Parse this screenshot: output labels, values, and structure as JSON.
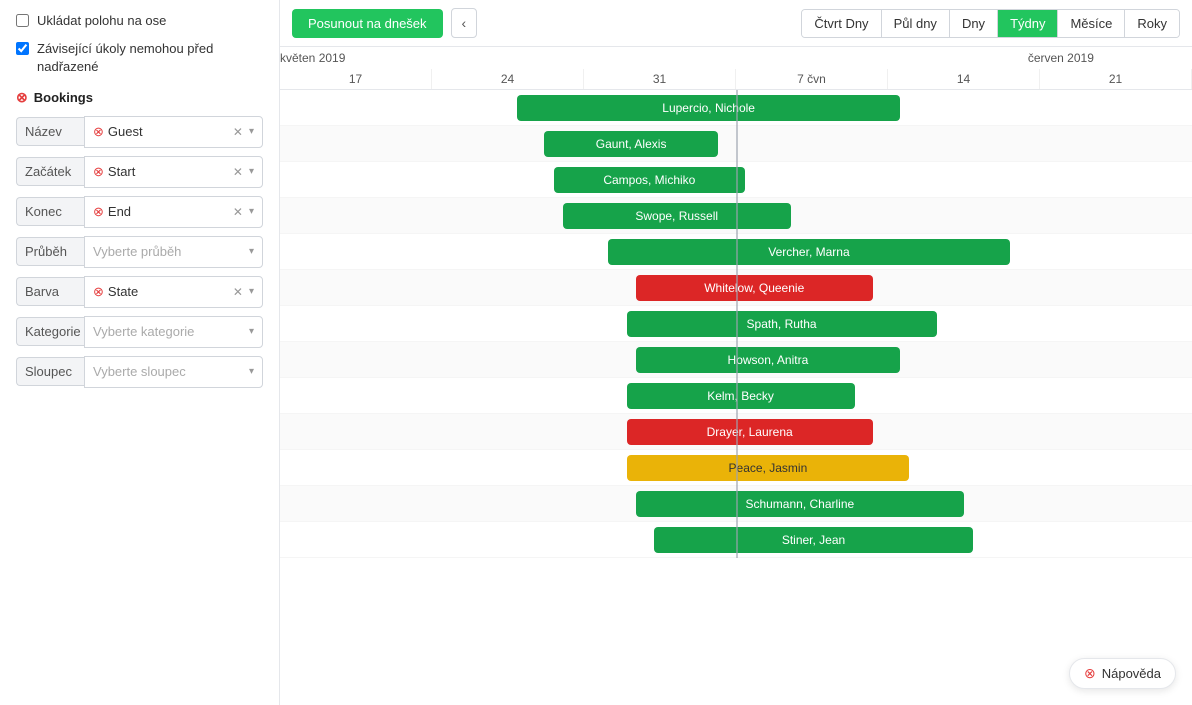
{
  "sidebar": {
    "checkbox1": {
      "label": "Ukládat polohu na ose",
      "checked": false
    },
    "checkbox2": {
      "label": "Závisející úkoly nemohou před nadřazené",
      "checked": true
    },
    "section": "Bookings",
    "fields": [
      {
        "label": "Název",
        "value": "Guest",
        "hasIcon": true,
        "hasClear": true,
        "placeholder": ""
      },
      {
        "label": "Začátek",
        "value": "Start",
        "hasIcon": true,
        "hasClear": true,
        "placeholder": ""
      },
      {
        "label": "Konec",
        "value": "End",
        "hasIcon": true,
        "hasClear": true,
        "placeholder": ""
      },
      {
        "label": "Průběh",
        "value": "",
        "hasIcon": false,
        "hasClear": false,
        "placeholder": "Vyberte průběh"
      },
      {
        "label": "Barva",
        "value": "State",
        "hasIcon": true,
        "hasClear": true,
        "placeholder": ""
      },
      {
        "label": "Kategorie",
        "value": "",
        "hasIcon": false,
        "hasClear": false,
        "placeholder": "Vyberte kategorie"
      },
      {
        "label": "Sloupec",
        "value": "",
        "hasIcon": false,
        "hasClear": false,
        "placeholder": "Vyberte sloupec"
      }
    ]
  },
  "toolbar": {
    "today_btn": "Posunout na dnešek",
    "nav_prev": "‹",
    "nav_next": "›",
    "view_buttons": [
      {
        "label": "Čtvrt Dny",
        "active": false
      },
      {
        "label": "Půl dny",
        "active": false
      },
      {
        "label": "Dny",
        "active": false
      },
      {
        "label": "Týdny",
        "active": true
      },
      {
        "label": "Měsíce",
        "active": false
      },
      {
        "label": "Roky",
        "active": false
      }
    ]
  },
  "gantt": {
    "months": [
      {
        "label": "květen 2019",
        "left_pct": 0
      },
      {
        "label": "červen 2019",
        "left_pct": 82
      }
    ],
    "days": [
      "17",
      "24",
      "31",
      "7 čvn",
      "14",
      "21"
    ],
    "bars": [
      {
        "name": "Lupercio, Nichole",
        "color": "green",
        "left_pct": 26,
        "width_pct": 42
      },
      {
        "name": "Gaunt, Alexis",
        "color": "green",
        "left_pct": 29,
        "width_pct": 19
      },
      {
        "name": "Campos, Michiko",
        "color": "green",
        "left_pct": 30,
        "width_pct": 21
      },
      {
        "name": "Swope, Russell",
        "color": "green",
        "left_pct": 31,
        "width_pct": 25
      },
      {
        "name": "Vercher, Marna",
        "color": "green",
        "left_pct": 36,
        "width_pct": 44
      },
      {
        "name": "Whitelow, Queenie",
        "color": "red",
        "left_pct": 39,
        "width_pct": 26
      },
      {
        "name": "Spath, Rutha",
        "color": "green",
        "left_pct": 38,
        "width_pct": 34
      },
      {
        "name": "Howson, Anitra",
        "color": "green",
        "left_pct": 39,
        "width_pct": 29
      },
      {
        "name": "Kelm, Becky",
        "color": "green",
        "left_pct": 38,
        "width_pct": 25
      },
      {
        "name": "Drayer, Laurena",
        "color": "red",
        "left_pct": 38,
        "width_pct": 27
      },
      {
        "name": "Peace, Jasmin",
        "color": "yellow",
        "left_pct": 38,
        "width_pct": 31
      },
      {
        "name": "Schumann, Charline",
        "color": "green",
        "left_pct": 39,
        "width_pct": 36
      },
      {
        "name": "Stiner, Jean",
        "color": "green",
        "left_pct": 41,
        "width_pct": 35
      }
    ],
    "vline_pct": 50
  },
  "help": {
    "label": "Nápověda",
    "icon": "❓"
  }
}
